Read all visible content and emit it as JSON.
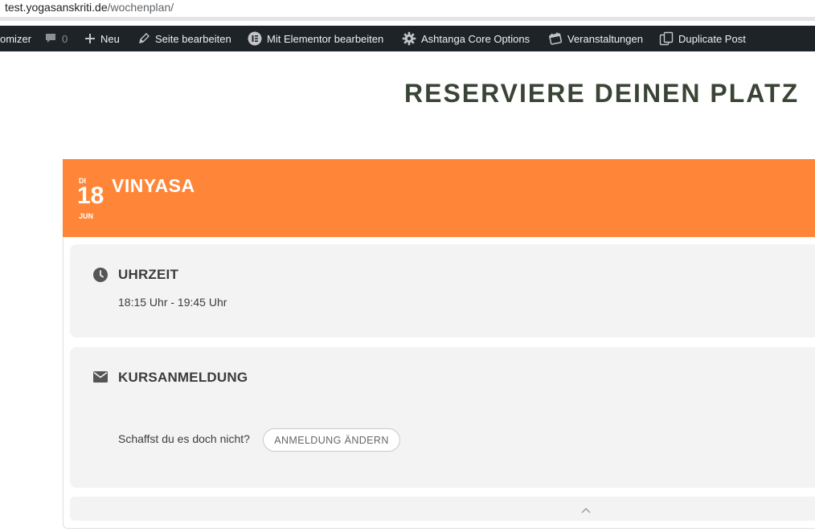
{
  "browser": {
    "url_host": "test.yogasanskriti.de",
    "url_path": "/wochenplan/"
  },
  "admin_bar": {
    "customizer_label": "omizer",
    "comments_count": "0",
    "new_label": "Neu",
    "edit_page_label": "Seite bearbeiten",
    "elementor_label": "Mit Elementor bearbeiten",
    "core_options_label": "Ashtanga Core Options",
    "events_label": "Veranstaltungen",
    "duplicate_label": "Duplicate Post"
  },
  "page": {
    "heading": "RESERVIERE DEINEN PLATZ"
  },
  "event": {
    "date_dow": "DI",
    "date_day": "18",
    "date_month": "JUN",
    "title": "VINYASA",
    "header_color": "#ff8638"
  },
  "time_section": {
    "icon": "clock-icon",
    "title": "UHRZEIT",
    "value": "18:15 Uhr - 19:45 Uhr"
  },
  "registration_section": {
    "icon": "envelope-icon",
    "title": "KURSANMELDUNG",
    "question": "Schaffst du es doch nicht?",
    "button_label": "ANMELDUNG ÄNDERN"
  },
  "collapse": {
    "icon": "chevron-up-icon"
  }
}
